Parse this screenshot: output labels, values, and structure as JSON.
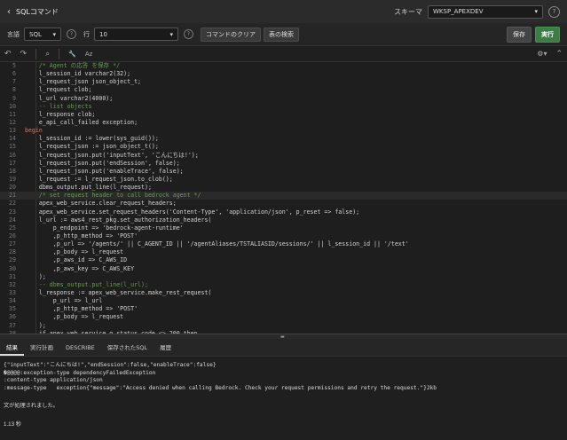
{
  "header": {
    "back_glyph": "‹",
    "title": "SQLコマンド",
    "schema_label": "スキーマ",
    "schema_value": "WKSP_APEXDEV",
    "help": "?"
  },
  "toolbar": {
    "language_label": "言語",
    "language_value": "SQL",
    "rows_label": "行",
    "rows_value": "10",
    "help": "?",
    "clear_label": "コマンドのクリア",
    "find_table_label": "表の検索",
    "save_label": "保存",
    "run_label": "実行"
  },
  "iconbar": {
    "undo": "↶",
    "redo": "↷",
    "search": "⌕",
    "wrench": "🔧",
    "case": "Aᴢ",
    "gear": "⚙▾",
    "fold": "⌃"
  },
  "editor": {
    "lines": [
      {
        "n": "5",
        "t": "    /* Agent の応答 を保存 */",
        "c": "#6a9955",
        "active": false
      },
      {
        "n": "6",
        "t": "    l_session_id varchar2(32);",
        "c": "#d4d4d4",
        "active": false
      },
      {
        "n": "7",
        "t": "    l_request_json json_object_t;",
        "c": "#d4d4d4",
        "active": false
      },
      {
        "n": "8",
        "t": "    l_request clob;",
        "c": "#d4d4d4",
        "active": false
      },
      {
        "n": "9",
        "t": "    l_url varchar2(4000);",
        "c": "#d4d4d4",
        "active": false
      },
      {
        "n": "10",
        "t": "    -- list objects",
        "c": "#6a9955",
        "active": false
      },
      {
        "n": "11",
        "t": "    l_response clob;",
        "c": "#d4d4d4",
        "active": false
      },
      {
        "n": "12",
        "t": "    e_api_call_failed exception;",
        "c": "#d4d4d4",
        "active": false
      },
      {
        "n": "13",
        "t": "begin",
        "c": "#e07a5f",
        "active": false
      },
      {
        "n": "14",
        "t": "    l_session_id := lower(sys_guid());",
        "c": "#d4d4d4",
        "active": false
      },
      {
        "n": "15",
        "t": "    l_request_json := json_object_t();",
        "c": "#d4d4d4",
        "active": false
      },
      {
        "n": "16",
        "t": "    l_request_json.put('inputText', 'こんにちは!');",
        "c": "#d4d4d4",
        "active": false
      },
      {
        "n": "17",
        "t": "    l_request_json.put('endSession', false);",
        "c": "#d4d4d4",
        "active": false
      },
      {
        "n": "18",
        "t": "    l_request_json.put('enableTrace', false);",
        "c": "#d4d4d4",
        "active": false
      },
      {
        "n": "19",
        "t": "    l_request := l_request_json.to_clob();",
        "c": "#d4d4d4",
        "active": false
      },
      {
        "n": "20",
        "t": "    dbms_output.put_line(l_request);",
        "c": "#d4d4d4",
        "active": false
      },
      {
        "n": "21",
        "t": "    /* set request header to call bedrock agent */",
        "c": "#6a9955",
        "active": true
      },
      {
        "n": "22",
        "t": "    apex_web_service.clear_request_headers;",
        "c": "#d4d4d4",
        "active": false
      },
      {
        "n": "23",
        "t": "    apex_web_service.set_request_headers('Content-Type', 'application/json', p_reset => false);",
        "c": "#d4d4d4",
        "active": false
      },
      {
        "n": "24",
        "t": "    l_url := aws4_rest_pkg.set_authorization_headers(",
        "c": "#d4d4d4",
        "active": false
      },
      {
        "n": "25",
        "t": "        p_endpoint => 'bedrock-agent-runtime'",
        "c": "#d4d4d4",
        "active": false
      },
      {
        "n": "26",
        "t": "        ,p_http_method => 'POST'",
        "c": "#d4d4d4",
        "active": false
      },
      {
        "n": "27",
        "t": "        ,p_url => '/agents/' || C_AGENT_ID || '/agentAliases/TSTALIASID/sessions/' || l_session_id || '/text'",
        "c": "#d4d4d4",
        "active": false
      },
      {
        "n": "28",
        "t": "        ,p_body => l_request",
        "c": "#d4d4d4",
        "active": false
      },
      {
        "n": "29",
        "t": "        ,p_aws_id => C_AWS_ID",
        "c": "#d4d4d4",
        "active": false
      },
      {
        "n": "30",
        "t": "        ,p_aws_key => C_AWS_KEY",
        "c": "#d4d4d4",
        "active": false
      },
      {
        "n": "31",
        "t": "    );",
        "c": "#d4d4d4",
        "active": false
      },
      {
        "n": "32",
        "t": "    -- dbms_output.put_line(l_url);",
        "c": "#6a9955",
        "active": false
      },
      {
        "n": "33",
        "t": "    l_response := apex_web_service.make_rest_request(",
        "c": "#d4d4d4",
        "active": false
      },
      {
        "n": "34",
        "t": "        p_url => l_url",
        "c": "#d4d4d4",
        "active": false
      },
      {
        "n": "35",
        "t": "        ,p_http_method => 'POST'",
        "c": "#d4d4d4",
        "active": false
      },
      {
        "n": "36",
        "t": "        ,p_body => l_request",
        "c": "#d4d4d4",
        "active": false
      },
      {
        "n": "37",
        "t": "    );",
        "c": "#d4d4d4",
        "active": false
      },
      {
        "n": "38",
        "t": "    if apex_web_service.g_status_code <> 200 then",
        "c": "#d4d4d4",
        "active": false
      }
    ]
  },
  "tabs": [
    {
      "label": "結果",
      "active": true
    },
    {
      "label": "実行計画",
      "active": false
    },
    {
      "label": "DESCRIBE",
      "active": false
    },
    {
      "label": "保存されたSQL",
      "active": false
    },
    {
      "label": "履歴",
      "active": false
    }
  ],
  "results": {
    "lines": [
      "{\"inputText\":\"こんにちは!\",\"endSession\":false,\"enableTrace\":false}",
      "�@@@@:exception-type dependencyFailedException",
      ":content-type application/json",
      ":message-type   exception{\"message\":\"Access denied when calling Bedrock. Check your request permissions and retry the request.\"}2kb"
    ],
    "done": "文が処理されました。",
    "time": "1.13 秒"
  },
  "colors": {
    "run_button": "#3d7c47",
    "keyword": "#e07a5f",
    "string": "#ce9178",
    "comment": "#6a9955"
  }
}
